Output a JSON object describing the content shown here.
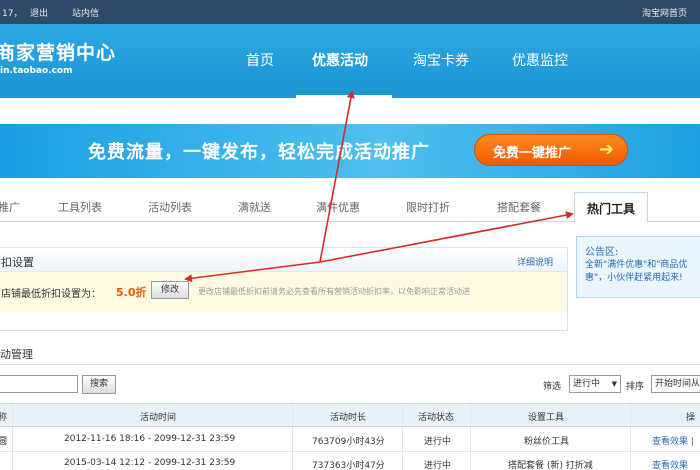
{
  "topbar": {
    "user_suffix": "17，",
    "logout": "退出",
    "messages": "站内信",
    "right_link": "淘宝网首页"
  },
  "header": {
    "logo_title": "商家营销中心",
    "logo_sub": "in.taobao.com",
    "nav": [
      {
        "label": "首页"
      },
      {
        "label": "优惠活动"
      },
      {
        "label": "淘宝卡券"
      },
      {
        "label": "优惠监控"
      }
    ]
  },
  "banner": {
    "text": "免费流量，一键发布，轻松完成活动推广",
    "button": "免费一键推广",
    "arrow": "➔"
  },
  "tabs": [
    {
      "label": "推广"
    },
    {
      "label": "工具列表"
    },
    {
      "label": "活动列表"
    },
    {
      "label": "满就送"
    },
    {
      "label": "满件优惠"
    },
    {
      "label": "限时打折"
    },
    {
      "label": "搭配套餐"
    },
    {
      "label": "热门工具"
    }
  ],
  "discount": {
    "title": "扣设置",
    "detail_link": "详细说明",
    "label": "店铺最低折扣设置为：",
    "value": "5.0折",
    "modify": "修改",
    "note": "更改店铺最低折扣前请务必先查看所有营销活动折扣率，以免影响正常活动进"
  },
  "notice": {
    "title": "公告区:",
    "text": "全新\"满件优惠\"和\"商品优惠\"，小伙伴赶紧用起来!"
  },
  "management": {
    "title": "动管理",
    "search_button": "搜索",
    "filter_label": "筛选",
    "filter_value": "进行中",
    "sort_label": "排序",
    "sort_value": "开始时间从"
  },
  "table": {
    "headers": [
      "称",
      "活动时间",
      "活动时长",
      "活动状态",
      "设置工具",
      "操"
    ],
    "rows": [
      {
        "name": "圆",
        "time": "2012-11-16 18:16 - 2099-12-31 23:59",
        "duration": "763709小时43分",
        "status": "进行中",
        "tool": "粉丝价工具",
        "action": "查看效果 |"
      },
      {
        "name": "",
        "time": "2015-03-14 12:12 - 2099-12-31 23:59",
        "duration": "737363小时47分",
        "status": "进行中",
        "tool": "搭配套餐 (新) 打折减",
        "action": "查看效果"
      }
    ]
  },
  "colors": {
    "header_bg": "#1c95d2",
    "topbar_bg": "#2f4a66",
    "promo_button": "#f05a00",
    "annotation_arrow": "#d42b2b",
    "discount_value": "#e35d00",
    "link": "#2c6cb5"
  }
}
